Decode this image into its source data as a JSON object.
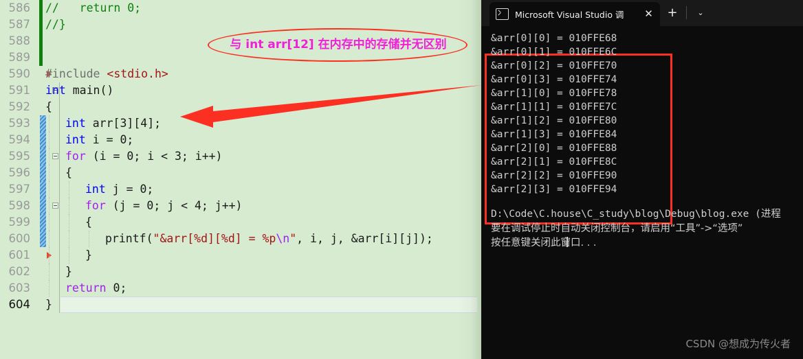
{
  "editor": {
    "lines": [
      {
        "num": "586",
        "tokens": [
          {
            "t": "//   return 0;",
            "c": "k-cmt"
          }
        ],
        "indent": 0,
        "gutter": "green"
      },
      {
        "num": "587",
        "tokens": [
          {
            "t": "//}",
            "c": "k-cmt"
          }
        ],
        "indent": 0,
        "gutter": "green"
      },
      {
        "num": "588",
        "tokens": [],
        "indent": 0,
        "gutter": "green"
      },
      {
        "num": "589",
        "tokens": [],
        "indent": 0,
        "gutter": "green"
      },
      {
        "num": "590",
        "tokens": [
          {
            "t": "#include ",
            "c": "k-pp"
          },
          {
            "t": "<stdio.h>",
            "c": "k-inc"
          }
        ],
        "indent": 0,
        "gutter": "none"
      },
      {
        "num": "591",
        "tokens": [
          {
            "t": "int",
            "c": "k-kw"
          },
          {
            "t": " main()",
            "c": "k-id"
          }
        ],
        "indent": 0,
        "gutter": "none"
      },
      {
        "num": "592",
        "tokens": [
          {
            "t": "{",
            "c": "k-punct"
          }
        ],
        "indent": 0,
        "gutter": "none"
      },
      {
        "num": "593",
        "tokens": [
          {
            "t": "int",
            "c": "k-kw"
          },
          {
            "t": " arr[3][4];",
            "c": "k-id"
          }
        ],
        "indent": 1,
        "gutter": "blue"
      },
      {
        "num": "594",
        "tokens": [
          {
            "t": "int",
            "c": "k-kw"
          },
          {
            "t": " i = 0;",
            "c": "k-id"
          }
        ],
        "indent": 1,
        "gutter": "blue"
      },
      {
        "num": "595",
        "tokens": [
          {
            "t": "for",
            "c": "k-ctl"
          },
          {
            "t": " (i = 0; i < 3; i++)",
            "c": "k-id"
          }
        ],
        "indent": 1,
        "gutter": "blue"
      },
      {
        "num": "596",
        "tokens": [
          {
            "t": "{",
            "c": "k-punct"
          }
        ],
        "indent": 1,
        "gutter": "blue"
      },
      {
        "num": "597",
        "tokens": [
          {
            "t": "int",
            "c": "k-kw"
          },
          {
            "t": " j = 0;",
            "c": "k-id"
          }
        ],
        "indent": 2,
        "gutter": "blue"
      },
      {
        "num": "598",
        "tokens": [
          {
            "t": "for",
            "c": "k-ctl"
          },
          {
            "t": " (j = 0; j < 4; j++)",
            "c": "k-id"
          }
        ],
        "indent": 2,
        "gutter": "blue"
      },
      {
        "num": "599",
        "tokens": [
          {
            "t": "{",
            "c": "k-punct"
          }
        ],
        "indent": 2,
        "gutter": "blue"
      },
      {
        "num": "600",
        "tokens": [
          {
            "t": "printf(",
            "c": "k-id"
          },
          {
            "t": "\"&arr[%d][%d] = %p",
            "c": "k-str"
          },
          {
            "t": "\\n",
            "c": "k-esc"
          },
          {
            "t": "\"",
            "c": "k-str"
          },
          {
            "t": ", i, j, &arr[i][j]);",
            "c": "k-id"
          }
        ],
        "indent": 3,
        "gutter": "blue"
      },
      {
        "num": "601",
        "tokens": [
          {
            "t": "}",
            "c": "k-punct"
          }
        ],
        "indent": 2,
        "gutter": "none"
      },
      {
        "num": "602",
        "tokens": [
          {
            "t": "}",
            "c": "k-punct"
          }
        ],
        "indent": 1,
        "gutter": "none"
      },
      {
        "num": "603",
        "tokens": [
          {
            "t": "return",
            "c": "k-ctl"
          },
          {
            "t": " 0;",
            "c": "k-id"
          }
        ],
        "indent": 1,
        "gutter": "none"
      },
      {
        "num": "604",
        "tokens": [
          {
            "t": "}",
            "c": "k-punct"
          }
        ],
        "indent": 0,
        "gutter": "none"
      }
    ],
    "background_color": "#d6ebd0"
  },
  "annotation": {
    "ellipse_text": "与 int arr[12] 在内存中的存储并无区别",
    "ellipse_color": "#fb2f22",
    "text_color": "#f020d8",
    "arrow_color": "#fb2f22",
    "arrow_target_line": "593"
  },
  "console": {
    "tab": {
      "title": "Microsoft Visual Studio 调试控",
      "icon": "terminal-icon",
      "close_label": "✕",
      "new_tab_label": "+",
      "dropdown_label": "⌄"
    },
    "highlight_box_color": "#fb2f22",
    "output_lines": [
      "&arr[0][0] = 010FFE68",
      "&arr[0][1] = 010FFE6C",
      "&arr[0][2] = 010FFE70",
      "&arr[0][3] = 010FFE74",
      "&arr[1][0] = 010FFE78",
      "&arr[1][1] = 010FFE7C",
      "&arr[1][2] = 010FFE80",
      "&arr[1][3] = 010FFE84",
      "&arr[2][0] = 010FFE88",
      "&arr[2][1] = 010FFE8C",
      "&arr[2][2] = 010FFE90",
      "&arr[2][3] = 010FFE94"
    ],
    "tail_lines": [
      "D:\\Code\\C.house\\C_study\\blog\\Debug\\blog.exe (进程",
      "要在调试停止时自动关闭控制台，请启用“工具”->“选项”",
      "按任意键关闭此窗口. . ."
    ],
    "background_color": "#0c0c0c",
    "text_color": "#cfcfcf"
  },
  "watermark": {
    "text": "CSDN @想成为传火者"
  }
}
